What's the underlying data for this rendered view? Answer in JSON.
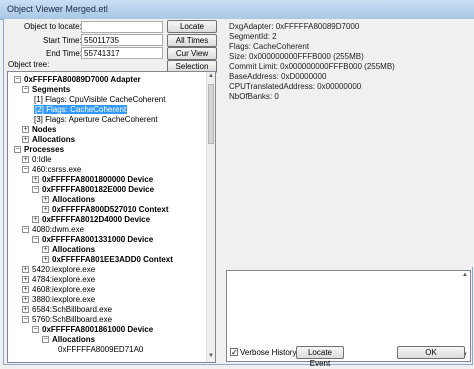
{
  "window": {
    "title": "Object Viewer Merged.etl"
  },
  "controls": {
    "object_label": "Object to locate:",
    "start_label": "Start Time:",
    "start_value": "55011735",
    "end_label": "End Time:",
    "end_value": "55741317",
    "tree_label": "Object tree:",
    "locate_button": "Locate",
    "all_times_button": "All Times",
    "cur_view_button": "Cur View Time",
    "selection_button": "Selection Time"
  },
  "tree": [
    {
      "text": "0xFFFFFA80089D7000 Adapter",
      "bold": true,
      "expander": "minus"
    },
    {
      "text": "Segments",
      "bold": true,
      "expander": "minus"
    },
    {
      "text": "[1] Flags: CpuVisible CacheCoherent",
      "bold": false,
      "expander": ""
    },
    {
      "text": "[2] Flags: CacheCoherent",
      "bold": false,
      "expander": "",
      "selected": true
    },
    {
      "text": "[3] Flags: Aperture CacheCoherent",
      "bold": false,
      "expander": ""
    },
    {
      "text": "Nodes",
      "bold": true,
      "expander": "plus"
    },
    {
      "text": "Allocations",
      "bold": true,
      "expander": "plus"
    },
    {
      "text": "Processes",
      "bold": true,
      "expander": "minus"
    },
    {
      "text": "0:Idle",
      "bold": false,
      "expander": "plus"
    },
    {
      "text": "460:csrss.exe",
      "bold": false,
      "expander": "minus"
    },
    {
      "text": "0xFFFFFA8001800000 Device",
      "bold": true,
      "expander": "plus"
    },
    {
      "text": "0xFFFFFA800182E000 Device",
      "bold": true,
      "expander": "minus"
    },
    {
      "text": "Allocations",
      "bold": true,
      "expander": "plus"
    },
    {
      "text": "0xFFFFFA800D527010 Context",
      "bold": true,
      "expander": "plus"
    },
    {
      "text": "0xFFFFFA8012D4000 Device",
      "bold": true,
      "expander": "plus"
    },
    {
      "text": "4080:dwm.exe",
      "bold": false,
      "expander": "minus"
    },
    {
      "text": "0xFFFFFA8001331000 Device",
      "bold": true,
      "expander": "minus"
    },
    {
      "text": "Allocations",
      "bold": true,
      "expander": "plus"
    },
    {
      "text": "0xFFFFFA801EE3ADD0 Context",
      "bold": true,
      "expander": "plus"
    },
    {
      "text": "5420:iexplore.exe",
      "bold": false,
      "expander": "plus"
    },
    {
      "text": "4784:iexplore.exe",
      "bold": false,
      "expander": "plus"
    },
    {
      "text": "4608:iexplore.exe",
      "bold": false,
      "expander": "plus"
    },
    {
      "text": "3880:iexplore.exe",
      "bold": false,
      "expander": "plus"
    },
    {
      "text": "6584:SchBillboard.exe",
      "bold": false,
      "expander": "plus"
    },
    {
      "text": "5760:SchBillboard.exe",
      "bold": false,
      "expander": "minus"
    },
    {
      "text": "0xFFFFFA8001861000 Device",
      "bold": true,
      "expander": "minus"
    },
    {
      "text": "Allocations",
      "bold": true,
      "expander": "minus"
    },
    {
      "text": "0xFFFFFA8009ED71A0",
      "bold": false,
      "expander": ""
    }
  ],
  "details": [
    "DxgAdapter: 0xFFFFFA80089D7000",
    "SegmentId: 2",
    "Flags: CacheCoherent",
    "Size: 0x000000000FFFB000 (255MB)",
    "Commit Limit: 0x000000000FFFB000 (255MB)",
    "BaseAddress: 0xD0000000",
    "CPUTranslatedAddress: 0x00000000",
    "NbOfBanks: 0"
  ],
  "footer": {
    "verbose_label": "Verbose History",
    "verbose_checked": true,
    "locate_event_button": "Locate Event",
    "ok_button": "OK"
  }
}
